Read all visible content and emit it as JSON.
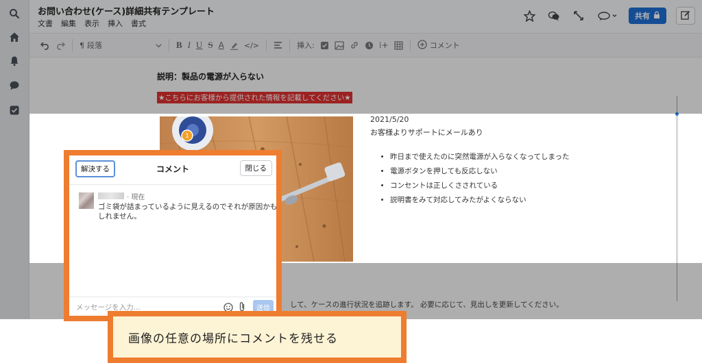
{
  "header": {
    "title": "お問い合わせ(ケース)詳細共有テンプレート",
    "menus": [
      "文書",
      "編集",
      "表示",
      "挿入",
      "書式"
    ],
    "share_label": "共有"
  },
  "toolbar": {
    "paragraph_label": "段落",
    "insert_label": "挿入:",
    "comment_label": "コメント"
  },
  "doc": {
    "heading": "説明：製品の電源が入らない",
    "notice": "★こちらにお客様から提供された情報を記載してください★",
    "date": "2021/5/20",
    "summary": "お客様よりサポートにメールあり",
    "bullets": [
      "昨日まで使えたのに突然電源が入らなくなってしまった",
      "電源ボタンを押しても反応しない",
      "コンセントは正しくさされている",
      "説明書をみて対応してみたがよくならない"
    ],
    "bottom_text": "して、ケースの進行状況を追跡します。 必要に応じて、見出しを更新してください。",
    "photo_marker": "1"
  },
  "comment_panel": {
    "resolve_label": "解決する",
    "title": "コメント",
    "close_label": "閉じる",
    "comment": {
      "time": "· 現在",
      "text": "ゴミ袋が詰まっているように見えるのでそれが原因かもしれません。"
    },
    "input_placeholder": "メッセージを入力...",
    "send_label": "送信"
  },
  "callout": {
    "text": "画像の任意の場所にコメントを残せる"
  },
  "colors": {
    "accent": "#1f6fd6",
    "callout_orange": "#ee7d30",
    "callout_fill": "#fdf3d5",
    "notice_red": "#e03131"
  }
}
